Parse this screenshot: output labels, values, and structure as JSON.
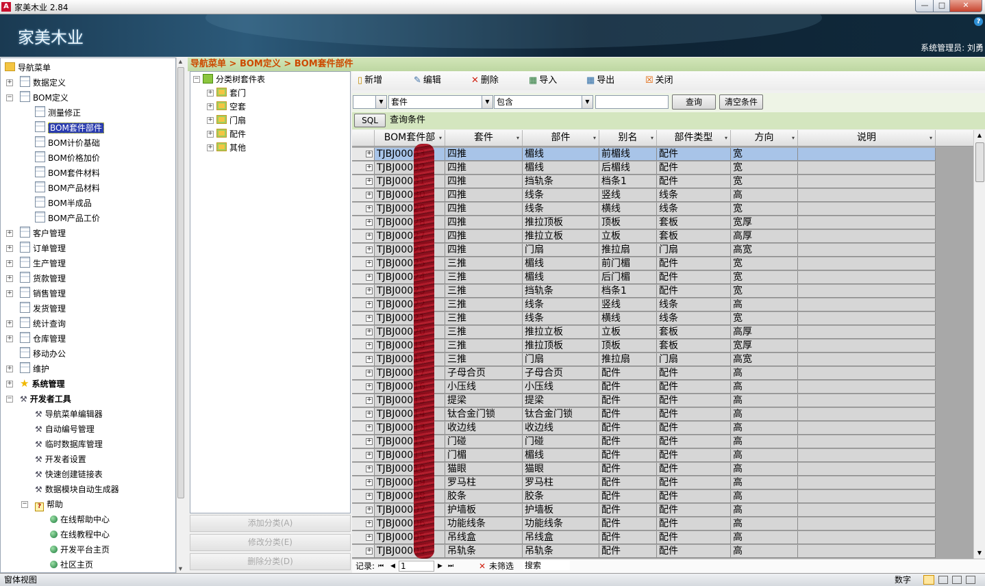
{
  "window": {
    "title": "家美木业 2.84",
    "app_icon": "A",
    "min": "—",
    "max": "□",
    "close": "✕"
  },
  "banner": {
    "brand": "家美木业",
    "help": "?",
    "user": "系统管理员: 刘勇"
  },
  "sidebar": {
    "items": [
      {
        "label": "导航菜单",
        "icon": "folder",
        "exp": "",
        "depth": 0
      },
      {
        "label": "数据定义",
        "icon": "doc",
        "exp": "+",
        "depth": 1
      },
      {
        "label": "BOM定义",
        "icon": "doc",
        "exp": "−",
        "depth": 1
      },
      {
        "label": "测量修正",
        "icon": "doc",
        "exp": "",
        "depth": 2
      },
      {
        "label": "BOM套件部件",
        "icon": "doc",
        "exp": "",
        "depth": 2,
        "selected": true
      },
      {
        "label": "BOM计价基础",
        "icon": "doc",
        "exp": "",
        "depth": 2
      },
      {
        "label": "BOM价格加价",
        "icon": "doc",
        "exp": "",
        "depth": 2
      },
      {
        "label": "BOM套件材料",
        "icon": "doc",
        "exp": "",
        "depth": 2
      },
      {
        "label": "BOM产品材料",
        "icon": "doc",
        "exp": "",
        "depth": 2
      },
      {
        "label": "BOM半成品",
        "icon": "doc",
        "exp": "",
        "depth": 2
      },
      {
        "label": "BOM产品工价",
        "icon": "doc",
        "exp": "",
        "depth": 2
      },
      {
        "label": "客户管理",
        "icon": "doc",
        "exp": "+",
        "depth": 1
      },
      {
        "label": "订单管理",
        "icon": "doc",
        "exp": "+",
        "depth": 1
      },
      {
        "label": "生产管理",
        "icon": "doc",
        "exp": "+",
        "depth": 1
      },
      {
        "label": "货款管理",
        "icon": "doc",
        "exp": "+",
        "depth": 1
      },
      {
        "label": "销售管理",
        "icon": "doc",
        "exp": "+",
        "depth": 1
      },
      {
        "label": "发货管理",
        "icon": "doc",
        "exp": "",
        "depth": 1
      },
      {
        "label": "统计查询",
        "icon": "doc",
        "exp": "+",
        "depth": 1
      },
      {
        "label": "仓库管理",
        "icon": "doc",
        "exp": "+",
        "depth": 1
      },
      {
        "label": "移动办公",
        "icon": "doc",
        "exp": "",
        "depth": 1
      },
      {
        "label": "维护",
        "icon": "doc",
        "exp": "+",
        "depth": 1
      },
      {
        "label": "系统管理",
        "icon": "star",
        "exp": "+",
        "depth": 1,
        "bold": true
      },
      {
        "label": "开发者工具",
        "icon": "tool",
        "exp": "−",
        "depth": 1,
        "bold": true
      },
      {
        "label": "导航菜单编辑器",
        "icon": "tool",
        "exp": "",
        "depth": 2
      },
      {
        "label": "自动编号管理",
        "icon": "tool",
        "exp": "",
        "depth": 2
      },
      {
        "label": "临时数据库管理",
        "icon": "tool",
        "exp": "",
        "depth": 2
      },
      {
        "label": "开发者设置",
        "icon": "tool",
        "exp": "",
        "depth": 2
      },
      {
        "label": "快速创建链接表",
        "icon": "tool",
        "exp": "",
        "depth": 2
      },
      {
        "label": "数据模块自动生成器",
        "icon": "tool",
        "exp": "",
        "depth": 2
      },
      {
        "label": "帮助",
        "icon": "qhelp",
        "exp": "−",
        "depth": 2
      },
      {
        "label": "在线帮助中心",
        "icon": "globe",
        "exp": "",
        "depth": 3
      },
      {
        "label": "在线教程中心",
        "icon": "globe",
        "exp": "",
        "depth": 3
      },
      {
        "label": "开发平台主页",
        "icon": "globe",
        "exp": "",
        "depth": 3
      },
      {
        "label": "社区主页",
        "icon": "globe",
        "exp": "",
        "depth": 3
      }
    ]
  },
  "breadcrumb": "导航菜单 > BOM定义 > BOM套件部件",
  "tree": {
    "root": "分类树套件表",
    "children": [
      "套门",
      "空套",
      "门扇",
      "配件",
      "其他"
    ],
    "add_label": "添加分类(A)",
    "edit_label": "修改分类(E)",
    "delete_label": "删除分类(D)"
  },
  "toolbar": {
    "new": "新增",
    "edit": "编辑",
    "delete": "删除",
    "import": "导入",
    "export": "导出",
    "close": "关闭"
  },
  "filter": {
    "prefix": "",
    "field": "套件",
    "operator": "包含",
    "value": "",
    "query_label": "查询",
    "clear_label": "清空条件",
    "sql_label": "SQL",
    "condition_label": "查询条件"
  },
  "grid": {
    "columns": [
      "BOM套件部",
      "套件",
      "部件",
      "别名",
      "部件类型",
      "方向",
      "说明"
    ],
    "rows": [
      [
        "TJBJ00033",
        "四推",
        "楣线",
        "前楣线",
        "配件",
        "宽",
        ""
      ],
      [
        "TJBJ00032",
        "四推",
        "楣线",
        "后楣线",
        "配件",
        "宽",
        ""
      ],
      [
        "TJBJ00031",
        "四推",
        "挡轨条",
        "档条1",
        "配件",
        "宽",
        ""
      ],
      [
        "TJBJ00030",
        "四推",
        "线条",
        "竖线",
        "线条",
        "高",
        ""
      ],
      [
        "TJBJ00029",
        "四推",
        "线条",
        "横线",
        "线条",
        "宽",
        ""
      ],
      [
        "TJBJ00028",
        "四推",
        "推拉顶板",
        "顶板",
        "套板",
        "宽厚",
        ""
      ],
      [
        "TJBJ00027",
        "四推",
        "推拉立板",
        "立板",
        "套板",
        "高厚",
        ""
      ],
      [
        "TJBJ00026",
        "四推",
        "门扇",
        "推拉扇",
        "门扇",
        "高宽",
        ""
      ],
      [
        "TJBJ00025",
        "三推",
        "楣线",
        "前门楣",
        "配件",
        "宽",
        ""
      ],
      [
        "TJBJ00024",
        "三推",
        "楣线",
        "后门楣",
        "配件",
        "宽",
        ""
      ],
      [
        "TJBJ00023",
        "三推",
        "挡轨条",
        "档条1",
        "配件",
        "宽",
        ""
      ],
      [
        "TJBJ00022",
        "三推",
        "线条",
        "竖线",
        "线条",
        "高",
        ""
      ],
      [
        "TJBJ00021",
        "三推",
        "线条",
        "横线",
        "线条",
        "宽",
        ""
      ],
      [
        "TJBJ00020",
        "三推",
        "推拉立板",
        "立板",
        "套板",
        "高厚",
        ""
      ],
      [
        "TJBJ00019",
        "三推",
        "推拉顶板",
        "顶板",
        "套板",
        "宽厚",
        ""
      ],
      [
        "TJBJ00018",
        "三推",
        "门扇",
        "推拉扇",
        "门扇",
        "高宽",
        ""
      ],
      [
        "TJBJ00017",
        "子母合页",
        "子母合页",
        "配件",
        "配件",
        "高",
        ""
      ],
      [
        "TJBJ00016",
        "小压线",
        "小压线",
        "配件",
        "配件",
        "高",
        ""
      ],
      [
        "TJBJ00015",
        "提梁",
        "提梁",
        "配件",
        "配件",
        "高",
        ""
      ],
      [
        "TJBJ00014",
        "钛合金门锁",
        "钛合金门锁",
        "配件",
        "配件",
        "高",
        ""
      ],
      [
        "TJBJ00013",
        "收边线",
        "收边线",
        "配件",
        "配件",
        "高",
        ""
      ],
      [
        "TJBJ00012",
        "门碰",
        "门碰",
        "配件",
        "配件",
        "高",
        ""
      ],
      [
        "TJBJ00011",
        "门楣",
        "楣线",
        "配件",
        "配件",
        "高",
        ""
      ],
      [
        "TJBJ00010",
        "猫眼",
        "猫眼",
        "配件",
        "配件",
        "高",
        ""
      ],
      [
        "TJBJ00009",
        "罗马柱",
        "罗马柱",
        "配件",
        "配件",
        "高",
        ""
      ],
      [
        "TJBJ00008",
        "胶条",
        "胶条",
        "配件",
        "配件",
        "高",
        ""
      ],
      [
        "TJBJ00007",
        "护墙板",
        "护墙板",
        "配件",
        "配件",
        "高",
        ""
      ],
      [
        "TJBJ00006",
        "功能线条",
        "功能线条",
        "配件",
        "配件",
        "高",
        ""
      ],
      [
        "TJBJ00005",
        "吊线盒",
        "吊线盒",
        "配件",
        "配件",
        "高",
        ""
      ],
      [
        "TJBJ00004",
        "吊轨条",
        "吊轨条",
        "配件",
        "配件",
        "高",
        ""
      ]
    ],
    "selected_row": 0
  },
  "navigator": {
    "records_label": "记录:",
    "first": "⏮",
    "prev": "◀",
    "page": "1",
    "next": "▶",
    "last": "⏭",
    "filter_label": "未筛选",
    "search_label": "搜索"
  },
  "status": {
    "left": "窗体视图",
    "right": "数字"
  }
}
